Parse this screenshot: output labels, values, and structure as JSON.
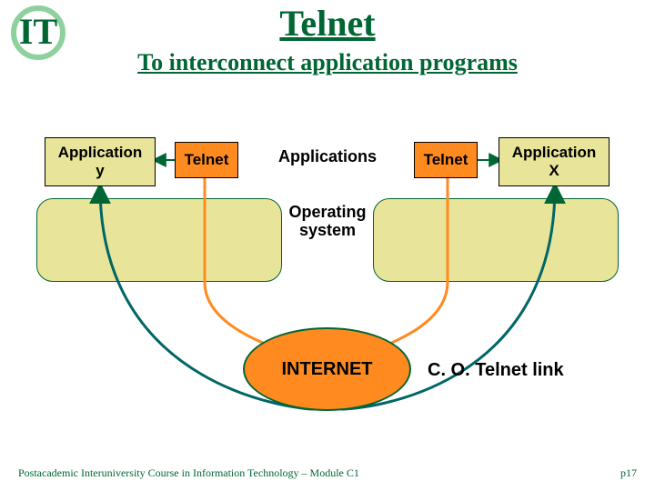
{
  "title": "Telnet",
  "subtitle": "To interconnect application programs",
  "boxes": {
    "app_y": "Application\ny",
    "telnet_left": "Telnet",
    "applications_label": "Applications",
    "telnet_right": "Telnet",
    "app_x": "Application\nX",
    "os_label": "Operating\nsystem"
  },
  "internet": "INTERNET",
  "co_link": "C. O. Telnet link",
  "footer": {
    "course": "Postacademic Interuniversity Course in Information Technology – Module C1",
    "page": "p17"
  },
  "colors": {
    "green": "#006633",
    "orange": "#ff8a1f",
    "olive": "#e8e49a"
  }
}
